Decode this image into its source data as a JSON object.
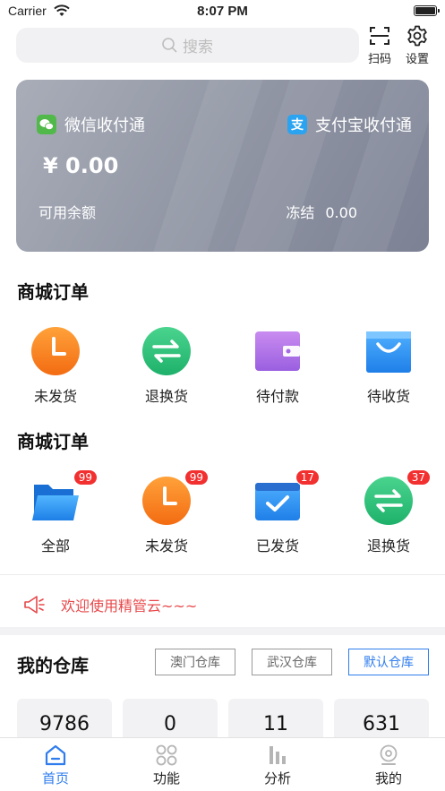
{
  "status_bar": {
    "carrier": "Carrier",
    "time": "8:07 PM"
  },
  "search": {
    "placeholder": "搜索"
  },
  "top_actions": {
    "scan": "扫码",
    "settings": "设置"
  },
  "wallet": {
    "wechat_label": "微信收付通",
    "alipay_label": "支付宝收付通",
    "balance": "¥ 0.00",
    "available_label": "可用余额",
    "frozen_label": "冻结",
    "frozen_value": "0.00",
    "colors": {
      "wechat": "#51b84a",
      "alipay": "#2aa3f0"
    }
  },
  "mall_orders": {
    "title": "商城订单",
    "items": [
      {
        "label": "未发货",
        "icon": "clock-icon"
      },
      {
        "label": "退换货",
        "icon": "exchange-icon"
      },
      {
        "label": "待付款",
        "icon": "wallet-icon"
      },
      {
        "label": "待收货",
        "icon": "bag-icon"
      }
    ]
  },
  "mall_orders_2": {
    "title": "商城订单",
    "items": [
      {
        "label": "全部",
        "icon": "folder-icon",
        "badge": "99"
      },
      {
        "label": "未发货",
        "icon": "clock-icon",
        "badge": "99"
      },
      {
        "label": "已发货",
        "icon": "box-check-icon",
        "badge": "17"
      },
      {
        "label": "退换货",
        "icon": "exchange-icon",
        "badge": "37"
      }
    ]
  },
  "notice": {
    "text": "欢迎使用精管云~~~",
    "color": "#e8484a"
  },
  "warehouse": {
    "title": "我的仓库",
    "buttons": [
      {
        "label": "澳门仓库",
        "active": false
      },
      {
        "label": "武汉仓库",
        "active": false
      },
      {
        "label": "默认仓库",
        "active": true
      }
    ],
    "stats": [
      "9786",
      "0",
      "11",
      "631"
    ]
  },
  "tabbar": {
    "items": [
      {
        "label": "首页",
        "icon": "home-icon",
        "active": true
      },
      {
        "label": "功能",
        "icon": "apps-icon",
        "active": false
      },
      {
        "label": "分析",
        "icon": "chart-icon",
        "active": false
      },
      {
        "label": "我的",
        "icon": "user-icon",
        "active": false
      }
    ],
    "accent": "#2f7ded"
  }
}
